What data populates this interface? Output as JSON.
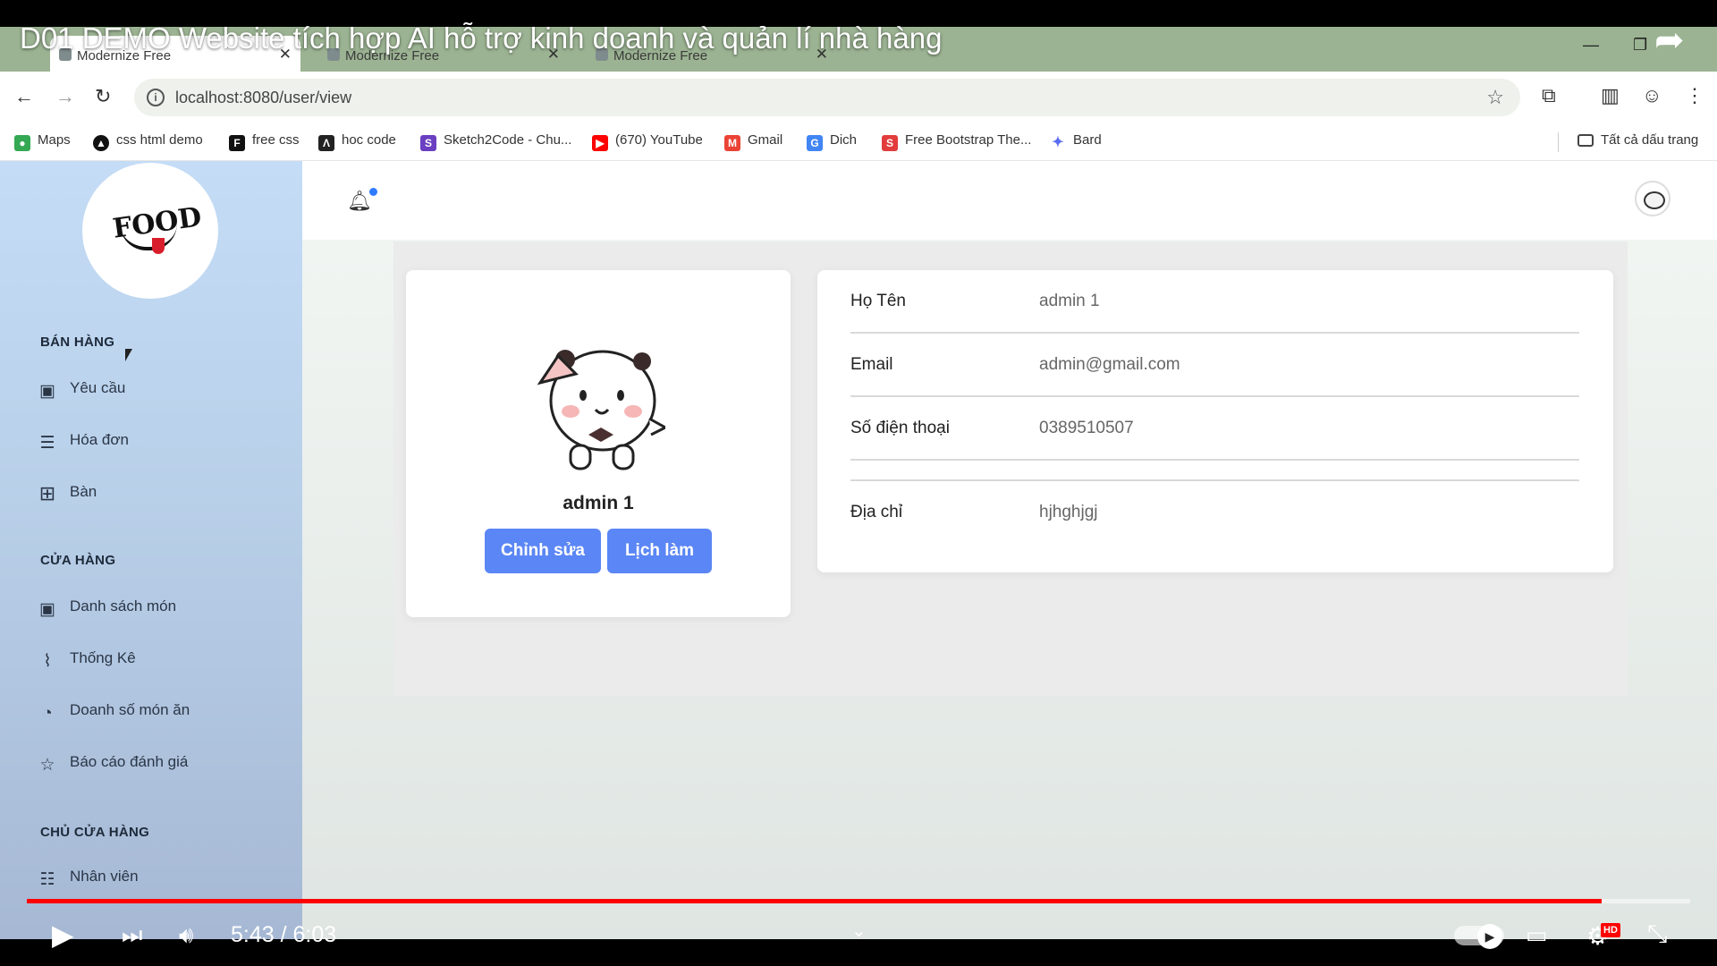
{
  "video": {
    "title": "D01 DEMO Website tích hợp AI hỗ trợ kinh doanh và quản lí nhà hàng",
    "current_time": "5:43",
    "duration": "6:03",
    "time_display": "5:43 / 6:03",
    "progress_fraction": 0.947,
    "hd_badge": "HD",
    "progress_color": "#ff0000"
  },
  "browser": {
    "tabs": [
      {
        "title": "Modernize Free"
      },
      {
        "title": "Modernize Free"
      },
      {
        "title": "Modernize Free"
      }
    ],
    "url": "localhost:8080/user/view",
    "bookmarks": [
      {
        "label": "Maps",
        "icon": "maps-icon",
        "color": "#34a853"
      },
      {
        "label": "css html demo",
        "icon": "triangle-icon",
        "color": "#111111"
      },
      {
        "label": "free css",
        "icon": "f-icon",
        "color": "#111111"
      },
      {
        "label": "hoc code",
        "icon": "code-icon",
        "color": "#222222"
      },
      {
        "label": "Sketch2Code - Chu...",
        "icon": "sketch2code-icon",
        "color": "#6a3fc1"
      },
      {
        "label": "(670) YouTube",
        "icon": "youtube-icon",
        "color": "#ff0000"
      },
      {
        "label": "Gmail",
        "icon": "gmail-icon",
        "color": "#ea4335"
      },
      {
        "label": "Dich",
        "icon": "translate-icon",
        "color": "#4285f4"
      },
      {
        "label": "Free Bootstrap The...",
        "icon": "s-icon",
        "color": "#e23c3c"
      },
      {
        "label": "Bard",
        "icon": "bard-icon",
        "color": "#5b6cf0"
      }
    ],
    "all_bookmarks": "Tất cả dấu trang"
  },
  "sidebar": {
    "sections": [
      {
        "title": "BÁN HÀNG",
        "items": [
          {
            "label": "Yêu cầu",
            "icon": "user-card-icon"
          },
          {
            "label": "Hóa đơn",
            "icon": "invoice-icon"
          },
          {
            "label": "Bàn",
            "icon": "grid-icon"
          }
        ]
      },
      {
        "title": "CỬA HÀNG",
        "items": [
          {
            "label": "Danh sách món",
            "icon": "user-card-icon"
          },
          {
            "label": "Thống Kê",
            "icon": "chart-line-icon"
          },
          {
            "label": "Doanh số món ăn",
            "icon": "pie-chart-icon"
          },
          {
            "label": "Báo cáo đánh giá",
            "icon": "star-icon"
          }
        ]
      },
      {
        "title": "CHỦ CỬA HÀNG",
        "items": [
          {
            "label": "Nhân viên",
            "icon": "users-list-icon"
          }
        ]
      }
    ],
    "logo_text": "FOOD"
  },
  "profile": {
    "name": "admin 1",
    "edit_button": "Chỉnh sửa",
    "schedule_button": "Lịch làm"
  },
  "info": {
    "rows": [
      {
        "label": "Họ Tên",
        "value": "admin 1"
      },
      {
        "label": "Email",
        "value": "admin@gmail.com"
      },
      {
        "label": "Số điện thoại",
        "value": "0389510507"
      },
      {
        "label": "Địa chỉ",
        "value": "hjhghjgj"
      }
    ]
  },
  "colors": {
    "primary_button": "#5b86f5",
    "sidebar_top": "#c4dcf6",
    "notification_dot": "#2f7bff"
  }
}
